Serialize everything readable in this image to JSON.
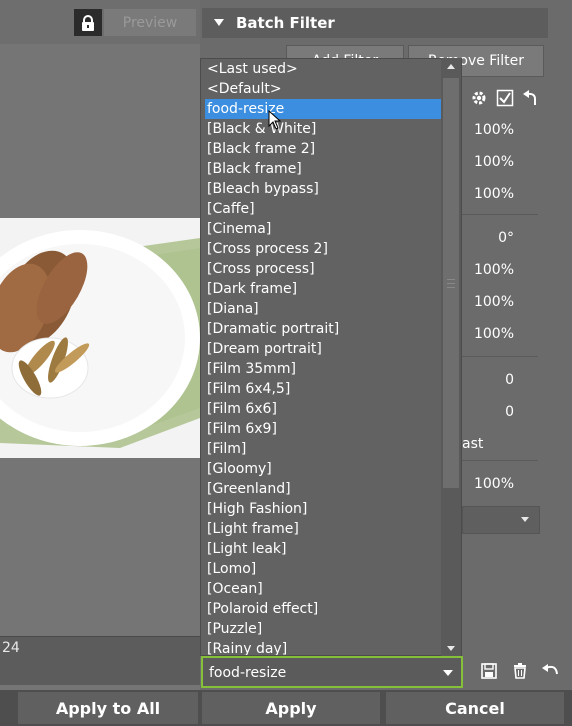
{
  "preview": {
    "preview_label": "Preview",
    "zoom_text": "24"
  },
  "batch_filter": {
    "title": "Batch Filter",
    "add_filter_label": "Add Filter",
    "remove_filter_label": "Remove Filter",
    "values": [
      "100%",
      "100%",
      "100%",
      "0°",
      "100%",
      "100%",
      "100%",
      "0",
      "0",
      "100%"
    ],
    "partial_label": "ast"
  },
  "dropdown": {
    "items": [
      "<Last used>",
      "<Default>",
      "food-resize",
      "[Black & White]",
      "[Black frame 2]",
      "[Black frame]",
      "[Bleach bypass]",
      "[Caffe]",
      "[Cinema]",
      "[Cross process 2]",
      "[Cross process]",
      "[Dark frame]",
      "[Diana]",
      "[Dramatic portrait]",
      "[Dream portrait]",
      "[Film 35mm]",
      "[Film 6x4,5]",
      "[Film 6x6]",
      "[Film 6x9]",
      "[Film]",
      "[Gloomy]",
      "[Greenland]",
      "[High Fashion]",
      "[Light frame]",
      "[Light leak]",
      "[Lomo]",
      "[Ocean]",
      "[Polaroid effect]",
      "[Puzzle]",
      "[Rainy day]"
    ],
    "selected": "food-resize"
  },
  "preset_combo": {
    "value": "food-resize"
  },
  "bottom": {
    "apply_all_label": "Apply to All",
    "apply_label": "Apply",
    "cancel_label": "Cancel"
  },
  "colors": {
    "accent_selection": "#3b8ee0",
    "combo_border": "#86c03a"
  }
}
